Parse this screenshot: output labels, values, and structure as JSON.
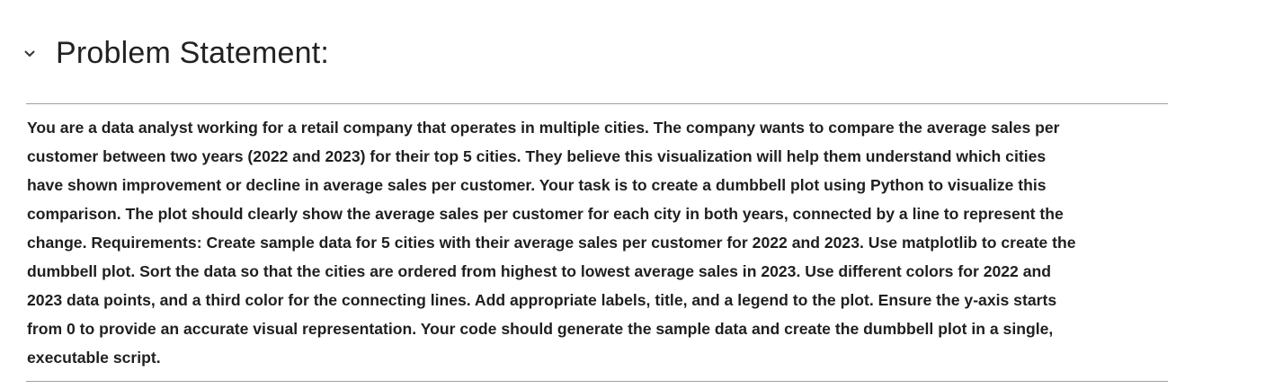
{
  "section": {
    "title": "Problem Statement:",
    "toggle_icon": "chevron-down-icon",
    "lines": [
      "You are a data analyst working for a retail company that operates in multiple cities. The company wants to compare the average sales per",
      "customer between two years (2022 and 2023) for their top 5 cities. They believe this visualization will help them understand which cities",
      "have shown improvement or decline in average sales per customer. Your task is to create a dumbbell plot using Python to visualize this",
      "comparison. The plot should clearly show the average sales per customer for each city in both years, connected by a line to represent the",
      "change. Requirements: Create sample data for 5 cities with their average sales per customer for 2022 and 2023. Use matplotlib to create the",
      "dumbbell plot. Sort the data so that the cities are ordered from highest to lowest average sales in 2023. Use different colors for 2022 and",
      "2023 data points, and a third color for the connecting lines. Add appropriate labels, title, and a legend to the plot. Ensure the y-axis starts",
      "from 0 to provide an accurate visual representation. Your code should generate the sample data and create the dumbbell plot in a single,",
      "executable script."
    ]
  }
}
